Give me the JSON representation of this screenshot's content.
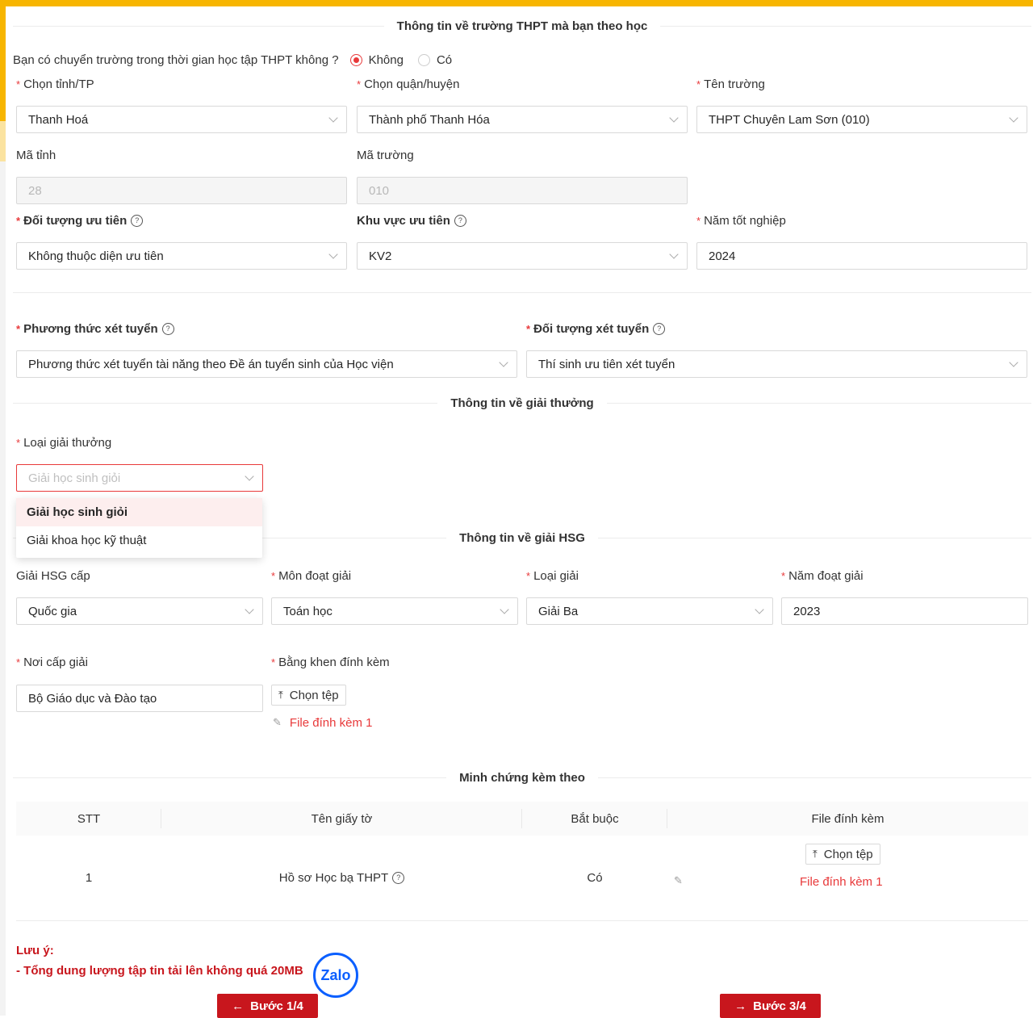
{
  "school_section": {
    "title": "Thông tin về trường THPT mà bạn theo học",
    "transfer_question": "Bạn có chuyển trường trong thời gian học tập THPT không ?",
    "option_no": "Không",
    "option_yes": "Có",
    "selected": "Không",
    "province": {
      "label": "Chọn tỉnh/TP",
      "value": "Thanh Hoá"
    },
    "district": {
      "label": "Chọn quận/huyện",
      "value": "Thành phố Thanh Hóa"
    },
    "school": {
      "label": "Tên trường",
      "value": "THPT Chuyên Lam Sơn (010)"
    },
    "province_code": {
      "label": "Mã tỉnh",
      "value": "28"
    },
    "school_code": {
      "label": "Mã trường",
      "value": "010"
    },
    "priority_group": {
      "label": "Đối tượng ưu tiên",
      "value": "Không thuộc diện ưu tiên"
    },
    "priority_area": {
      "label": "Khu vực ưu tiên",
      "value": "KV2"
    },
    "graduation_year": {
      "label": "Năm tốt nghiệp",
      "value": "2024"
    }
  },
  "admission": {
    "method": {
      "label": "Phương thức xét tuyển",
      "value": "Phương thức xét tuyển tài năng theo Đề án tuyển sinh của Học viện"
    },
    "target": {
      "label": "Đối tượng xét tuyển",
      "value": "Thí sinh ưu tiên xét tuyển"
    }
  },
  "award_section": {
    "title": "Thông tin về giải thưởng",
    "award_type": {
      "label": "Loại giải thưởng",
      "placeholder": "Giải học sinh giỏi"
    },
    "dropdown_options": [
      "Giải học sinh giỏi",
      "Giải khoa học kỹ thuật"
    ]
  },
  "hsg_section": {
    "title": "Thông tin về giải HSG",
    "level": {
      "label": "Giải HSG cấp",
      "value": "Quốc gia"
    },
    "subject": {
      "label": "Môn đoạt giải",
      "value": "Toán học"
    },
    "prize": {
      "label": "Loại giải",
      "value": "Giải Ba"
    },
    "year": {
      "label": "Năm đoạt giải",
      "value": "2023"
    },
    "issuer": {
      "label": "Nơi cấp giải",
      "value": "Bộ Giáo dục và Đào tạo"
    },
    "certificate": {
      "label": "Bằng khen đính kèm",
      "button": "Chọn tệp",
      "file": "File đính kèm 1"
    }
  },
  "evidence_section": {
    "title": "Minh chứng kèm theo",
    "columns": [
      "STT",
      "Tên giấy tờ",
      "Bắt buộc",
      "File đính kèm"
    ],
    "rows": [
      {
        "stt": "1",
        "name": "Hồ sơ Học bạ THPT",
        "required": "Có",
        "button": "Chọn tệp",
        "file": "File đính kèm 1"
      }
    ]
  },
  "note": {
    "title": "Lưu ý:",
    "text": "- Tổng dung lượng tập tin tải lên không quá 20MB"
  },
  "nav": {
    "prev": "Bước 1/4",
    "next": "Bước 3/4"
  },
  "zalo_label": "Zalo",
  "colors": {
    "accent": "#e8393a",
    "button": "#c8161d",
    "stripe": "#f7b500"
  }
}
